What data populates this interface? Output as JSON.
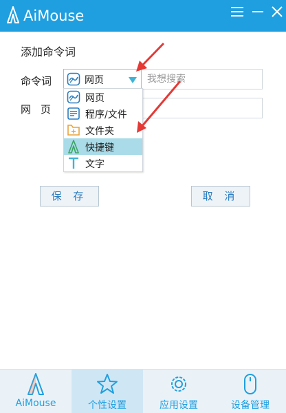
{
  "window": {
    "title": "AiMouse",
    "controls": [
      "menu-icon",
      "minimize-icon",
      "close-icon"
    ]
  },
  "colors": {
    "titlebar": "#1f9fdf",
    "accent": "#1f9fdf",
    "highlight": "#a9dbe8",
    "annotation_arrow": "#e53935"
  },
  "form": {
    "heading": "添加命令词",
    "command_label": "命令词",
    "web_label": "网页",
    "type_select": {
      "selected": "网页",
      "icon": "webpage-icon"
    },
    "command_input": {
      "value": "",
      "placeholder": "我想搜索"
    },
    "web_input": {
      "value": ""
    }
  },
  "dropdown": {
    "items": [
      {
        "label": "网页",
        "icon": "webpage-icon",
        "highlighted": false
      },
      {
        "label": "程序/文件",
        "icon": "program-file-icon",
        "highlighted": false
      },
      {
        "label": "文件夹",
        "icon": "folder-icon",
        "highlighted": false
      },
      {
        "label": "快捷键",
        "icon": "shortcut-icon",
        "highlighted": true
      },
      {
        "label": "文字",
        "icon": "text-icon",
        "highlighted": false
      }
    ]
  },
  "buttons": {
    "save": "保 存",
    "cancel": "取 消"
  },
  "nav": {
    "items": [
      {
        "label": "AiMouse",
        "icon": "aimouse-logo-icon",
        "active": false
      },
      {
        "label": "个性设置",
        "icon": "star-icon",
        "active": true
      },
      {
        "label": "应用设置",
        "icon": "gear-icon",
        "active": false
      },
      {
        "label": "设备管理",
        "icon": "mouse-icon",
        "active": false
      }
    ]
  }
}
